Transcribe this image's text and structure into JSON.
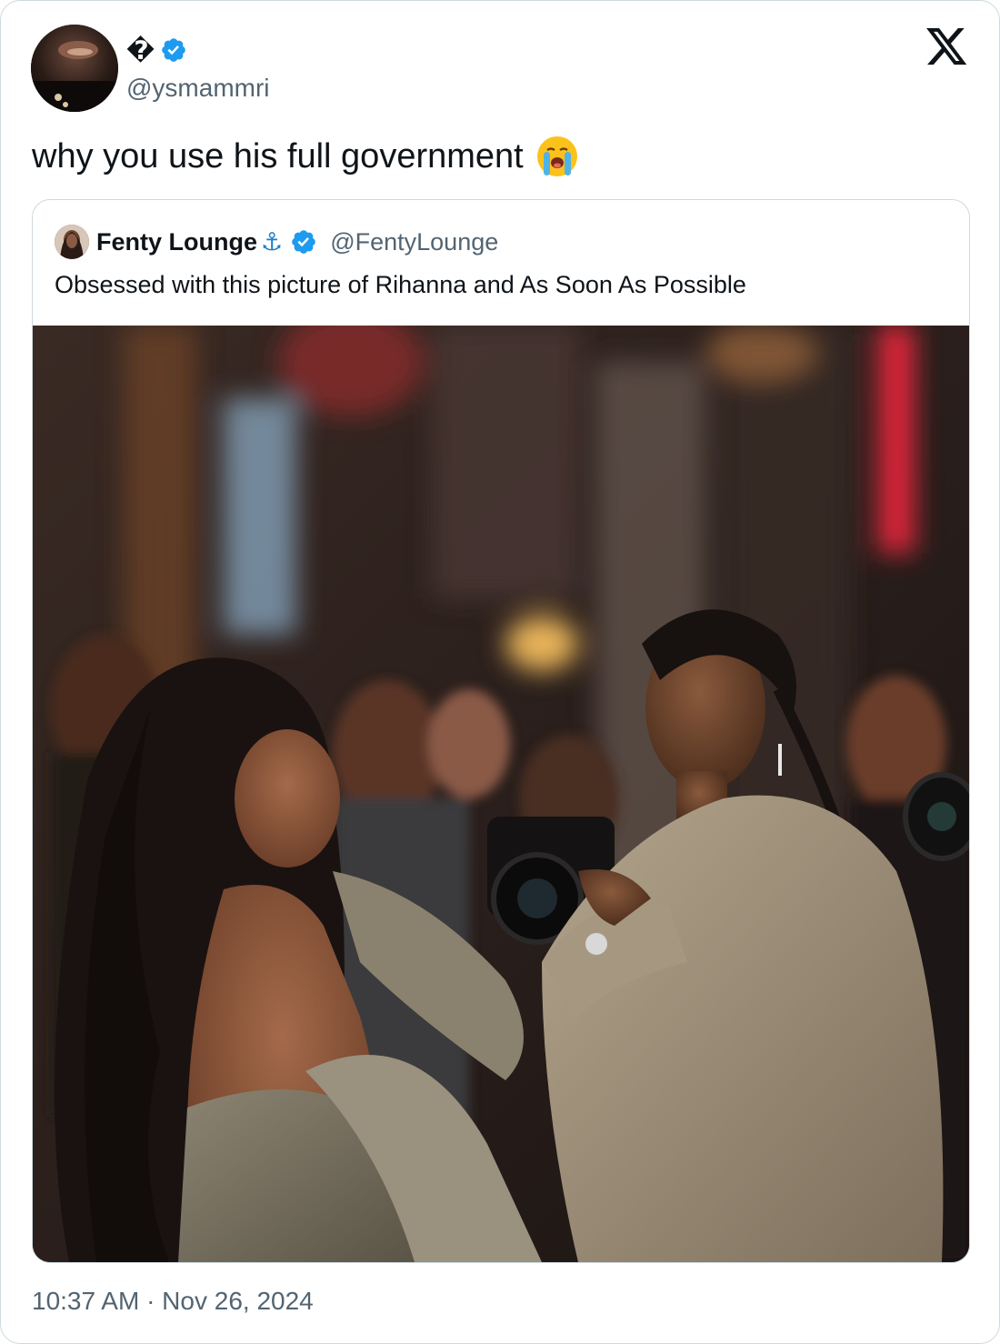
{
  "tweet": {
    "display_name": "�",
    "handle": "@ysmammri",
    "text": "why you use his full government",
    "timestamp": "10:37 AM · Nov 26, 2024",
    "icons": {
      "verified": "verified-badge-icon",
      "platform": "x-logo-icon",
      "emoji": "loudly-crying-face-emoji"
    }
  },
  "quoted_tweet": {
    "display_name": "Fenty Lounge",
    "name_emoji": "⚓",
    "handle": "@FentyLounge",
    "text": "Obsessed with this picture of Rihanna and As Soon As Possible",
    "media": "photo"
  },
  "colors": {
    "verified_blue": "#1d9bf0",
    "secondary_text": "#536471",
    "border": "#cfd9de"
  }
}
